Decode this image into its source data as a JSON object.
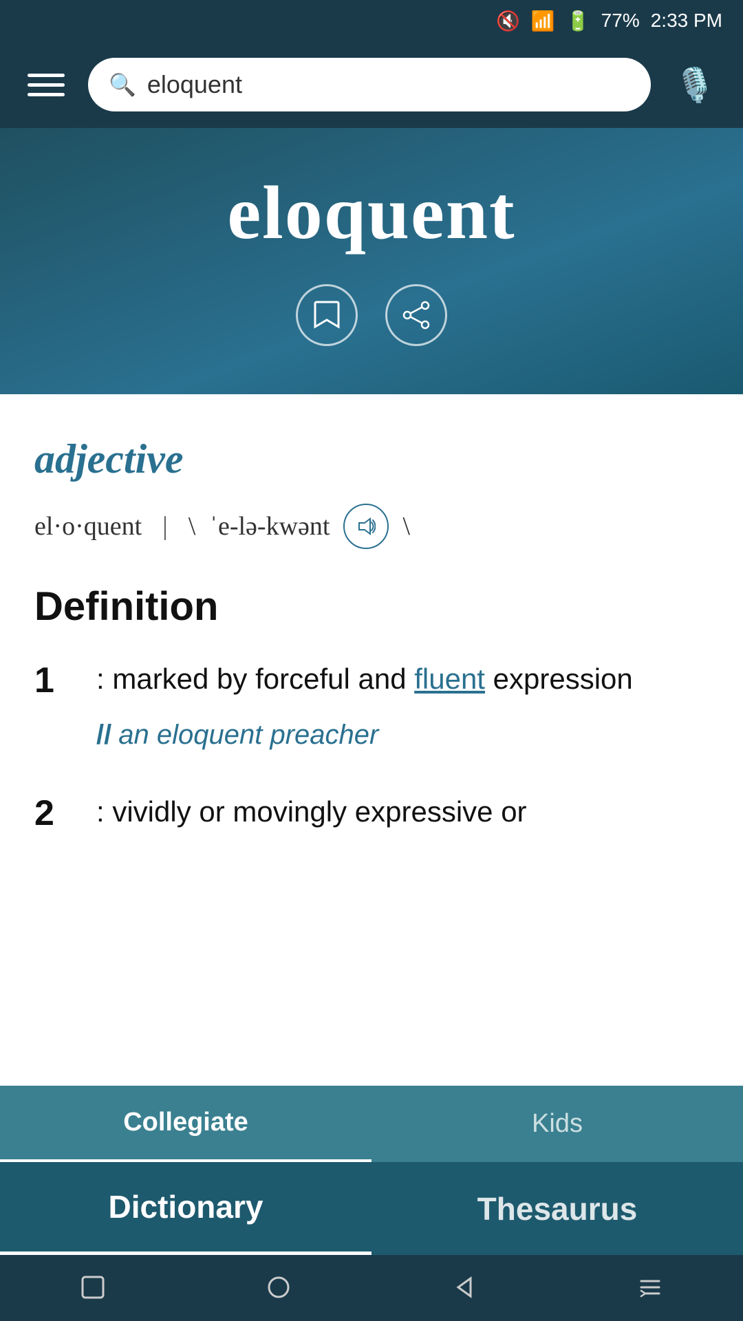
{
  "statusBar": {
    "muted": true,
    "wifi": true,
    "battery": "77%",
    "time": "2:33 PM"
  },
  "topNav": {
    "searchValue": "eloquent",
    "searchPlaceholder": "Search"
  },
  "wordHeader": {
    "word": "eloquent",
    "bookmarkLabel": "bookmark",
    "shareLabel": "share"
  },
  "wordEntry": {
    "partOfSpeech": "adjective",
    "syllables": "el·o·quent",
    "pronunciation": "\\ ˈe-lə-kwənt \\",
    "definitionHeader": "Definition",
    "definitions": [
      {
        "number": "1",
        "colon": ":",
        "text": "marked by forceful and ",
        "link": "fluent",
        "textAfterLink": " expression",
        "example": "an eloquent preacher"
      },
      {
        "number": "2",
        "colon": ":",
        "text": "vividly or movingly expressive or",
        "link": "",
        "textAfterLink": "",
        "example": ""
      }
    ]
  },
  "subTabs": [
    {
      "label": "Collegiate",
      "active": true
    },
    {
      "label": "Kids",
      "active": false
    }
  ],
  "mainTabs": [
    {
      "label": "Dictionary",
      "active": true
    },
    {
      "label": "Thesaurus",
      "active": false
    }
  ],
  "androidNav": {
    "squareLabel": "recent-apps",
    "circleLabel": "home",
    "triangleLabel": "back",
    "menuLabel": "menu"
  }
}
